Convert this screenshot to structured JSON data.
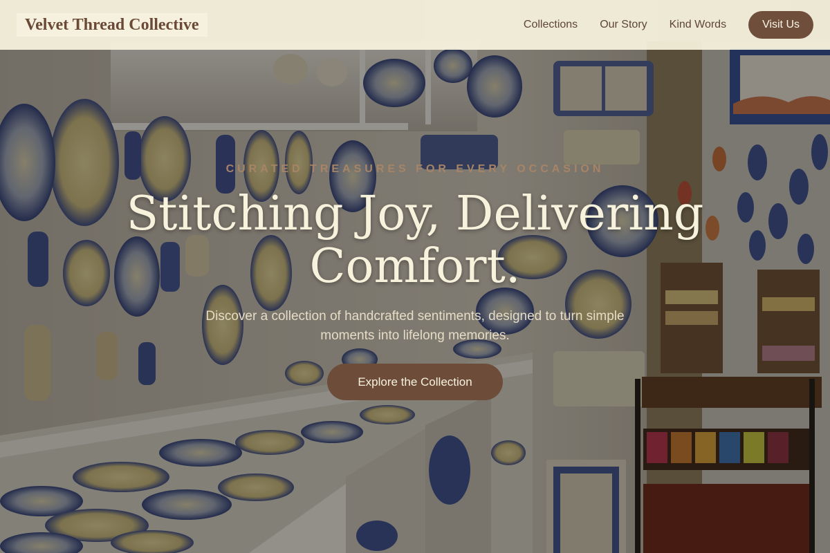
{
  "header": {
    "logo_text": "Velvet Thread Collective",
    "nav": [
      {
        "label": "Collections"
      },
      {
        "label": "Our Story"
      },
      {
        "label": "Kind Words"
      }
    ],
    "cta_label": "Visit Us"
  },
  "hero": {
    "eyebrow": "CURATED TREASURES FOR EVERY OCCASION",
    "headline": "Stitching Joy, Delivering Comfort.",
    "subtext": "Discover a collection of handcrafted sentiments, designed to turn simple moments into lifelong memories.",
    "cta_label": "Explore the Collection"
  },
  "colors": {
    "header_bg": "#f8f4de",
    "brand_brown": "#6f4e3b",
    "headline_cream": "#f7f2dc",
    "eyebrow_tan": "#a78466"
  }
}
